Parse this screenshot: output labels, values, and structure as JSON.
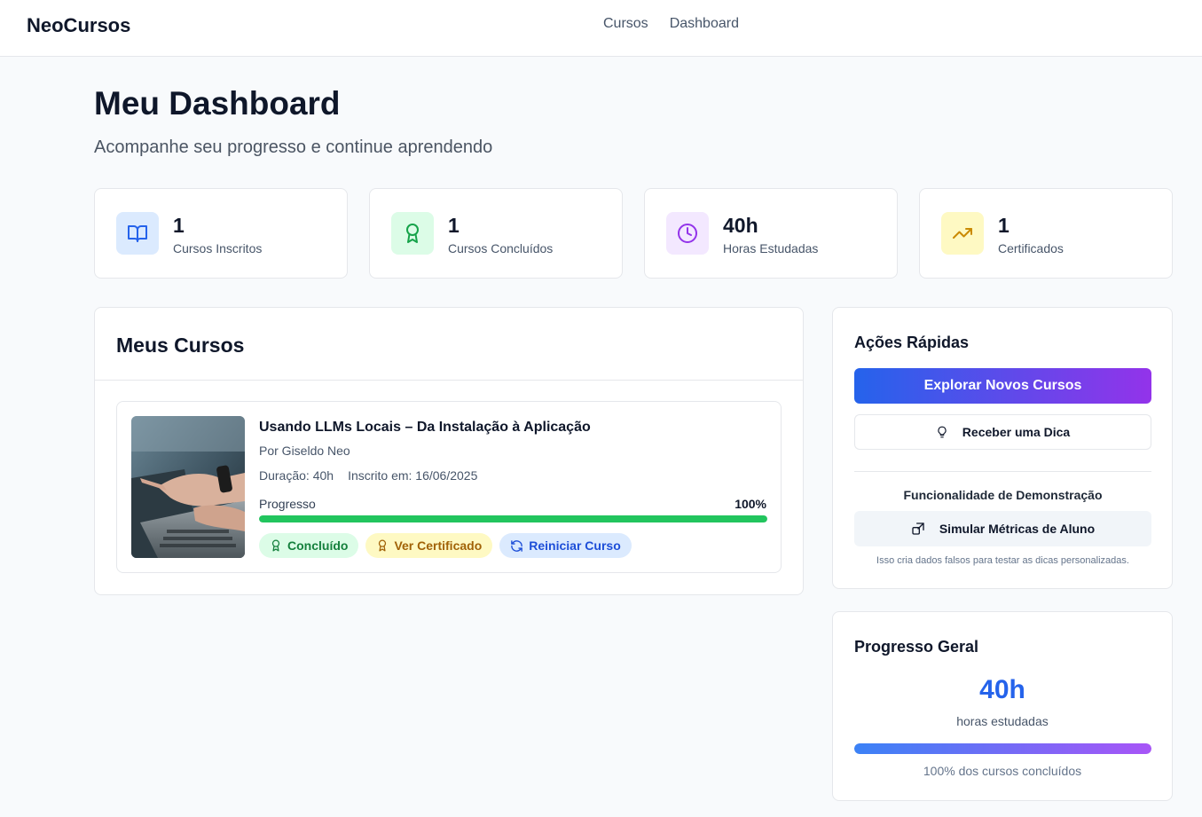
{
  "header": {
    "brand": "NeoCursos",
    "nav": [
      "Cursos",
      "Dashboard"
    ]
  },
  "page": {
    "title": "Meu Dashboard",
    "subtitle": "Acompanhe seu progresso e continue aprendendo"
  },
  "stats": [
    {
      "value": "1",
      "label": "Cursos Inscritos",
      "icon": "book-open-icon",
      "color": "#2563eb",
      "bg": "#dbeafe"
    },
    {
      "value": "1",
      "label": "Cursos Concluídos",
      "icon": "award-icon",
      "color": "#16a34a",
      "bg": "#dcfce7"
    },
    {
      "value": "40h",
      "label": "Horas Estudadas",
      "icon": "clock-icon",
      "color": "#9333ea",
      "bg": "#f3e8ff"
    },
    {
      "value": "1",
      "label": "Certificados",
      "icon": "trending-up-icon",
      "color": "#ca8a04",
      "bg": "#fef9c3"
    }
  ],
  "courses": {
    "title": "Meus Cursos",
    "items": [
      {
        "title": "Usando LLMs Locais – Da Instalação à Aplicação",
        "author": "Por Giseldo Neo",
        "duration": "Duração: 40h",
        "enrolled": "Inscrito em: 16/06/2025",
        "progress_label": "Progresso",
        "progress_text": "100%",
        "progress": 1.0,
        "badges": {
          "completed": "Concluído",
          "certificate": "Ver Certificado",
          "restart": "Reiniciar Curso"
        }
      }
    ]
  },
  "quick_actions": {
    "title": "Ações Rápidas",
    "explore": "Explorar Novos Cursos",
    "tip": "Receber uma Dica",
    "demo_title": "Funcionalidade de Demonstração",
    "simulate": "Simular Métricas de Aluno",
    "demo_note": "Isso cria dados falsos para testar as dicas personalizadas."
  },
  "overall": {
    "title": "Progresso Geral",
    "value": "40h",
    "label": "horas estudadas",
    "progress": 1.0,
    "note": "100% dos cursos concluídos"
  },
  "colors": {
    "accent_blue": "#2563eb",
    "accent_purple": "#9333ea",
    "success": "#22c55e"
  }
}
